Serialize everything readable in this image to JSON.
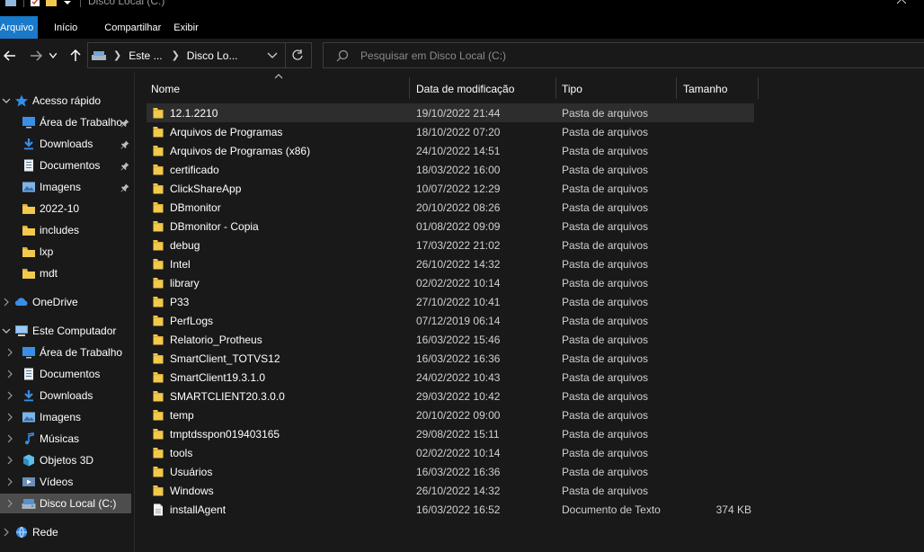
{
  "window": {
    "title": "Disco Local (C:)",
    "controls": [
      "minimize",
      "maximize",
      "close"
    ]
  },
  "ribbon": {
    "tabs": [
      {
        "label": "Arquivo",
        "active": true
      },
      {
        "label": "Início",
        "active": false
      },
      {
        "label": "Compartilhar",
        "active": false
      },
      {
        "label": "Exibir",
        "active": false
      }
    ]
  },
  "address": {
    "breadcrumb": [
      "Este ...",
      "Disco Lo..."
    ],
    "search_placeholder": "Pesquisar em Disco Local (C:)"
  },
  "sidebar": {
    "quick_access": {
      "label": "Acesso rápido",
      "items": [
        {
          "label": "Área de Trabalho",
          "icon": "desktop-icon",
          "pinned": true
        },
        {
          "label": "Downloads",
          "icon": "download-icon",
          "pinned": true
        },
        {
          "label": "Documentos",
          "icon": "document-icon",
          "pinned": true
        },
        {
          "label": "Imagens",
          "icon": "pictures-icon",
          "pinned": true
        },
        {
          "label": "2022-10",
          "icon": "folder-icon",
          "pinned": false
        },
        {
          "label": "includes",
          "icon": "folder-icon",
          "pinned": false
        },
        {
          "label": "lxp",
          "icon": "folder-icon",
          "pinned": false
        },
        {
          "label": "mdt",
          "icon": "folder-icon",
          "pinned": false
        }
      ]
    },
    "onedrive": {
      "label": "OneDrive"
    },
    "this_pc": {
      "label": "Este Computador",
      "items": [
        {
          "label": "Área de Trabalho",
          "icon": "desktop-icon"
        },
        {
          "label": "Documentos",
          "icon": "document-icon"
        },
        {
          "label": "Downloads",
          "icon": "download-icon"
        },
        {
          "label": "Imagens",
          "icon": "pictures-icon"
        },
        {
          "label": "Músicas",
          "icon": "music-icon"
        },
        {
          "label": "Objetos 3D",
          "icon": "objects-3d-icon"
        },
        {
          "label": "Vídeos",
          "icon": "videos-icon"
        },
        {
          "label": "Disco Local (C:)",
          "icon": "drive-icon",
          "selected": true
        }
      ]
    },
    "network": {
      "label": "Rede"
    }
  },
  "columns": {
    "name": "Nome",
    "modified": "Data de modificação",
    "type": "Tipo",
    "size": "Tamanho"
  },
  "files": [
    {
      "name": "12.1.2210",
      "modified": "19/10/2022 21:44",
      "type": "Pasta de arquivos",
      "size": "",
      "kind": "folder"
    },
    {
      "name": "Arquivos de Programas",
      "modified": "18/10/2022 07:20",
      "type": "Pasta de arquivos",
      "size": "",
      "kind": "folder"
    },
    {
      "name": "Arquivos de Programas (x86)",
      "modified": "24/10/2022 14:51",
      "type": "Pasta de arquivos",
      "size": "",
      "kind": "folder"
    },
    {
      "name": "certificado",
      "modified": "18/03/2022 16:00",
      "type": "Pasta de arquivos",
      "size": "",
      "kind": "folder"
    },
    {
      "name": "ClickShareApp",
      "modified": "10/07/2022 12:29",
      "type": "Pasta de arquivos",
      "size": "",
      "kind": "folder"
    },
    {
      "name": "DBmonitor",
      "modified": "20/10/2022 08:26",
      "type": "Pasta de arquivos",
      "size": "",
      "kind": "folder"
    },
    {
      "name": "DBmonitor - Copia",
      "modified": "01/08/2022 09:09",
      "type": "Pasta de arquivos",
      "size": "",
      "kind": "folder"
    },
    {
      "name": "debug",
      "modified": "17/03/2022 21:02",
      "type": "Pasta de arquivos",
      "size": "",
      "kind": "folder"
    },
    {
      "name": "Intel",
      "modified": "26/10/2022 14:32",
      "type": "Pasta de arquivos",
      "size": "",
      "kind": "folder"
    },
    {
      "name": "library",
      "modified": "02/02/2022 10:14",
      "type": "Pasta de arquivos",
      "size": "",
      "kind": "folder"
    },
    {
      "name": "P33",
      "modified": "27/10/2022 10:41",
      "type": "Pasta de arquivos",
      "size": "",
      "kind": "folder"
    },
    {
      "name": "PerfLogs",
      "modified": "07/12/2019 06:14",
      "type": "Pasta de arquivos",
      "size": "",
      "kind": "folder"
    },
    {
      "name": "Relatorio_Protheus",
      "modified": "16/03/2022 15:46",
      "type": "Pasta de arquivos",
      "size": "",
      "kind": "folder"
    },
    {
      "name": "SmartClient_TOTVS12",
      "modified": "16/03/2022 16:36",
      "type": "Pasta de arquivos",
      "size": "",
      "kind": "folder"
    },
    {
      "name": "SmartClient19.3.1.0",
      "modified": "24/02/2022 10:43",
      "type": "Pasta de arquivos",
      "size": "",
      "kind": "folder"
    },
    {
      "name": "SMARTCLIENT20.3.0.0",
      "modified": "29/03/2022 10:42",
      "type": "Pasta de arquivos",
      "size": "",
      "kind": "folder"
    },
    {
      "name": "temp",
      "modified": "20/10/2022 09:00",
      "type": "Pasta de arquivos",
      "size": "",
      "kind": "folder"
    },
    {
      "name": "tmptdsspon019403165",
      "modified": "29/08/2022 15:11",
      "type": "Pasta de arquivos",
      "size": "",
      "kind": "folder"
    },
    {
      "name": "tools",
      "modified": "02/02/2022 10:14",
      "type": "Pasta de arquivos",
      "size": "",
      "kind": "folder"
    },
    {
      "name": "Usuários",
      "modified": "16/03/2022 16:36",
      "type": "Pasta de arquivos",
      "size": "",
      "kind": "folder"
    },
    {
      "name": "Windows",
      "modified": "26/10/2022 14:32",
      "type": "Pasta de arquivos",
      "size": "",
      "kind": "folder"
    },
    {
      "name": "installAgent",
      "modified": "16/03/2022 16:52",
      "type": "Documento de Texto",
      "size": "374 KB",
      "kind": "text-file"
    }
  ],
  "colors": {
    "background": "#191919",
    "ribbon_active": "#1979ca",
    "folder": "#f2c94c",
    "selected": "#4d4d4d",
    "hover_row": "#2d2d2d"
  }
}
